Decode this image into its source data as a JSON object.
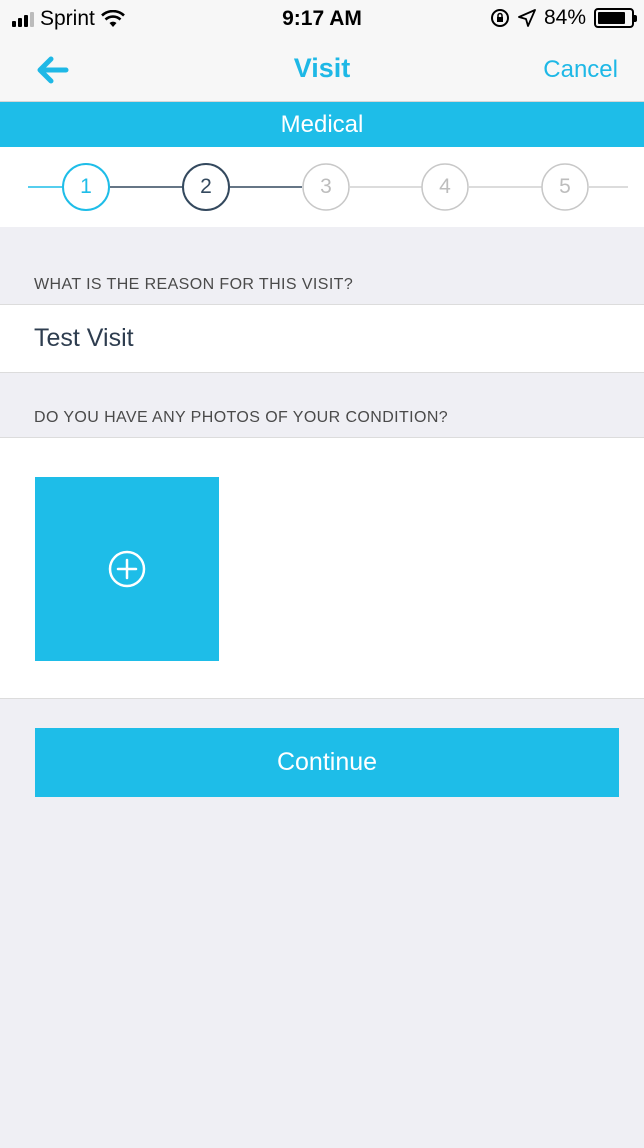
{
  "status_bar": {
    "carrier": "Sprint",
    "time": "9:17 AM",
    "battery": "84%",
    "battery_level": 0.84
  },
  "nav": {
    "title": "Visit",
    "cancel_label": "Cancel",
    "back_icon": "arrow-left-icon"
  },
  "section": {
    "title": "Medical"
  },
  "stepper": {
    "steps": [
      "1",
      "2",
      "3",
      "4",
      "5"
    ],
    "completed_step": "1",
    "current_step": "2"
  },
  "questions": {
    "reason_label": "WHAT IS THE REASON FOR THIS VISIT?",
    "reason_value": "Test Visit",
    "photos_label": "DO YOU HAVE ANY PHOTOS OF YOUR CONDITION?"
  },
  "actions": {
    "add_photo_icon": "plus-circle-icon",
    "continue_label": "Continue"
  },
  "colors": {
    "accent": "#1ebde8",
    "current_step": "#34495e",
    "inactive_step": "#c8c8c8"
  }
}
